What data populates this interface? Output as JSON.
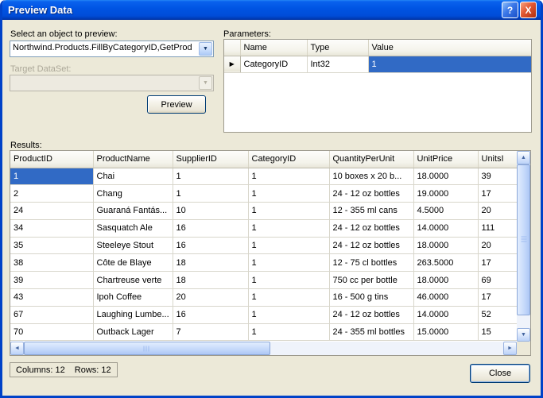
{
  "window": {
    "title": "Preview Data"
  },
  "icons": {
    "help": "?",
    "close": "X",
    "dropdown": "▼",
    "current_row": "▶",
    "scroll_up": "▲",
    "scroll_down": "▼",
    "scroll_left": "◄",
    "scroll_right": "►"
  },
  "object_picker": {
    "label": "Select an object to preview:",
    "value": "Northwind.Products.FillByCategoryID,GetProd"
  },
  "target_dataset": {
    "label": "Target DataSet:",
    "value": ""
  },
  "buttons": {
    "preview": "Preview",
    "close": "Close"
  },
  "parameters": {
    "label": "Parameters:",
    "columns": [
      "Name",
      "Type",
      "Value"
    ],
    "rows": [
      [
        "CategoryID",
        "Int32",
        "1"
      ]
    ]
  },
  "results": {
    "label": "Results:",
    "columns": [
      "ProductID",
      "ProductName",
      "SupplierID",
      "CategoryID",
      "QuantityPerUnit",
      "UnitPrice",
      "UnitsI"
    ],
    "rows": [
      [
        "1",
        "Chai",
        "1",
        "1",
        "10 boxes x 20 b...",
        "18.0000",
        "39"
      ],
      [
        "2",
        "Chang",
        "1",
        "1",
        "24 - 12 oz bottles",
        "19.0000",
        "17"
      ],
      [
        "24",
        "Guaraná Fantás...",
        "10",
        "1",
        "12 - 355 ml cans",
        "4.5000",
        "20"
      ],
      [
        "34",
        "Sasquatch Ale",
        "16",
        "1",
        "24 - 12 oz bottles",
        "14.0000",
        "111"
      ],
      [
        "35",
        "Steeleye Stout",
        "16",
        "1",
        "24 - 12 oz bottles",
        "18.0000",
        "20"
      ],
      [
        "38",
        "Côte de Blaye",
        "18",
        "1",
        "12 - 75 cl bottles",
        "263.5000",
        "17"
      ],
      [
        "39",
        "Chartreuse verte",
        "18",
        "1",
        "750 cc per bottle",
        "18.0000",
        "69"
      ],
      [
        "43",
        "Ipoh Coffee",
        "20",
        "1",
        "16 - 500 g tins",
        "46.0000",
        "17"
      ],
      [
        "67",
        "Laughing Lumbe...",
        "16",
        "1",
        "24 - 12 oz bottles",
        "14.0000",
        "52"
      ],
      [
        "70",
        "Outback Lager",
        "7",
        "1",
        "24 - 355 ml bottles",
        "15.0000",
        "15"
      ]
    ]
  },
  "status": {
    "columns": "Columns: 12",
    "rows": "Rows: 12"
  },
  "colors": {
    "selection": "#316AC5",
    "titlebar": "#0054E3",
    "dialog_bg": "#ECE9D8"
  }
}
